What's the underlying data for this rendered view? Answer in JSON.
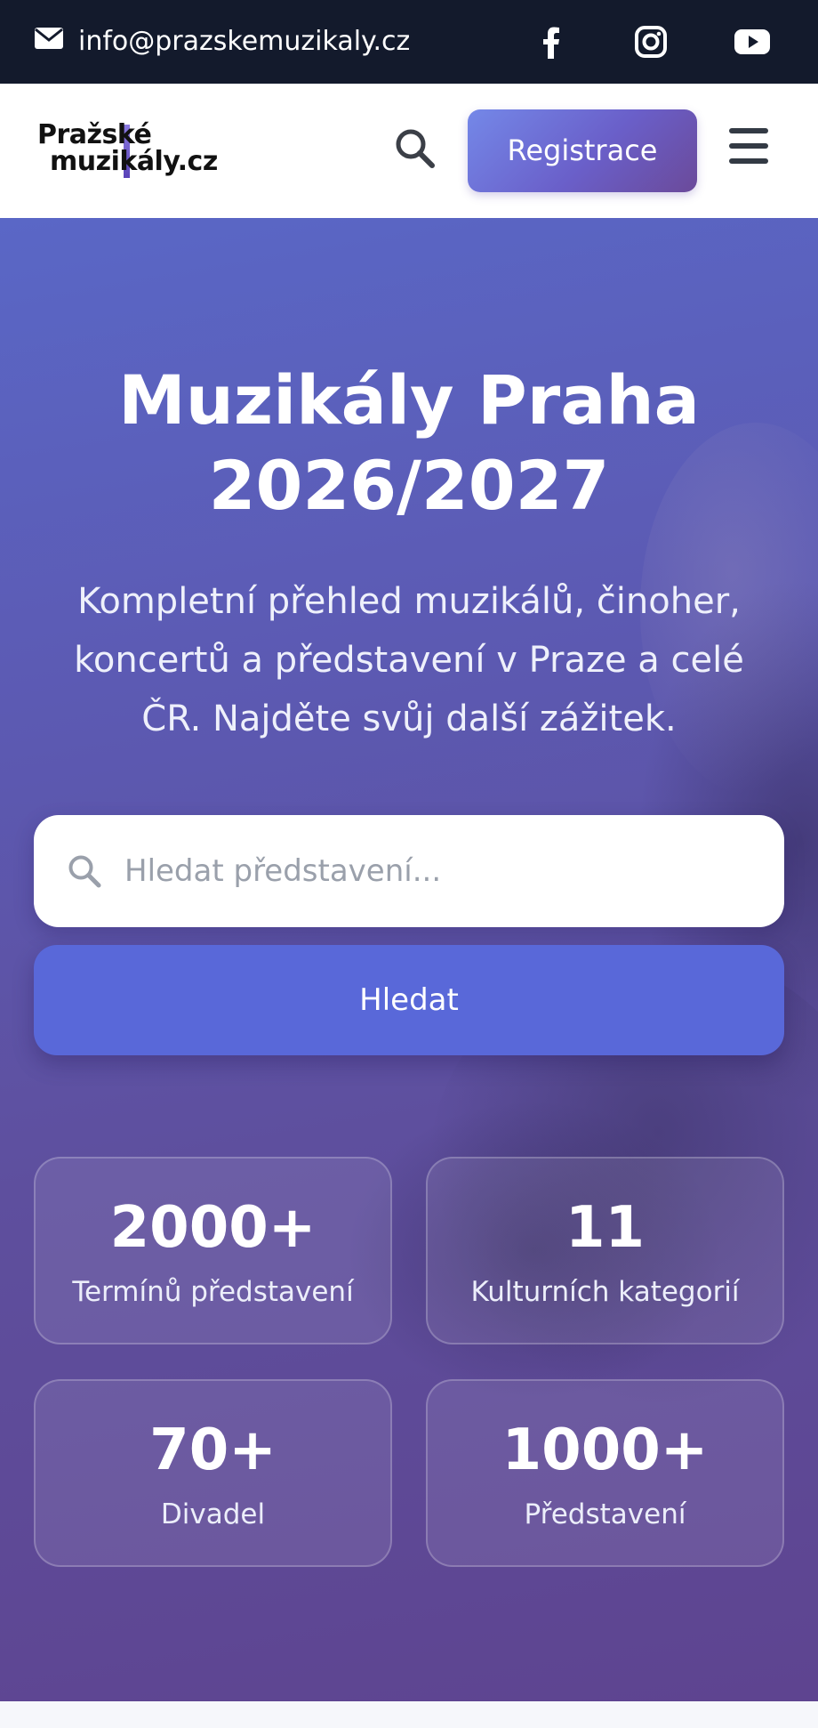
{
  "topbar": {
    "email": "info@prazskemuzikaly.cz",
    "icons": [
      "mail-icon",
      "facebook-icon",
      "instagram-icon",
      "youtube-icon"
    ]
  },
  "header": {
    "logo_line1": "Pražské",
    "logo_line2": "muzikály.cz",
    "register_label": "Registrace",
    "icons": [
      "search-icon",
      "hamburger-menu-icon"
    ]
  },
  "hero": {
    "title_line1": "Muzikály Praha",
    "title_line2": "2026/2027",
    "subtitle_line1": "Kompletní přehled muzikálů, činoher,",
    "subtitle_line2": "koncertů a představení v Praze a celé",
    "subtitle_line3": "ČR. Najděte svůj další zážitek.",
    "search_placeholder": "Hledat představení...",
    "search_button": "Hledat"
  },
  "stats": [
    {
      "value": "2000+",
      "label": "Termínů představení"
    },
    {
      "value": "11",
      "label": "Kulturních kategorií"
    },
    {
      "value": "70+",
      "label": "Divadel"
    },
    {
      "value": "1000+",
      "label": "Představení"
    }
  ],
  "colors": {
    "topbar_bg": "#131a2c",
    "accent": "#5968d9",
    "hero_gradient_start": "#5a67c6",
    "hero_gradient_end": "#5e4490"
  }
}
